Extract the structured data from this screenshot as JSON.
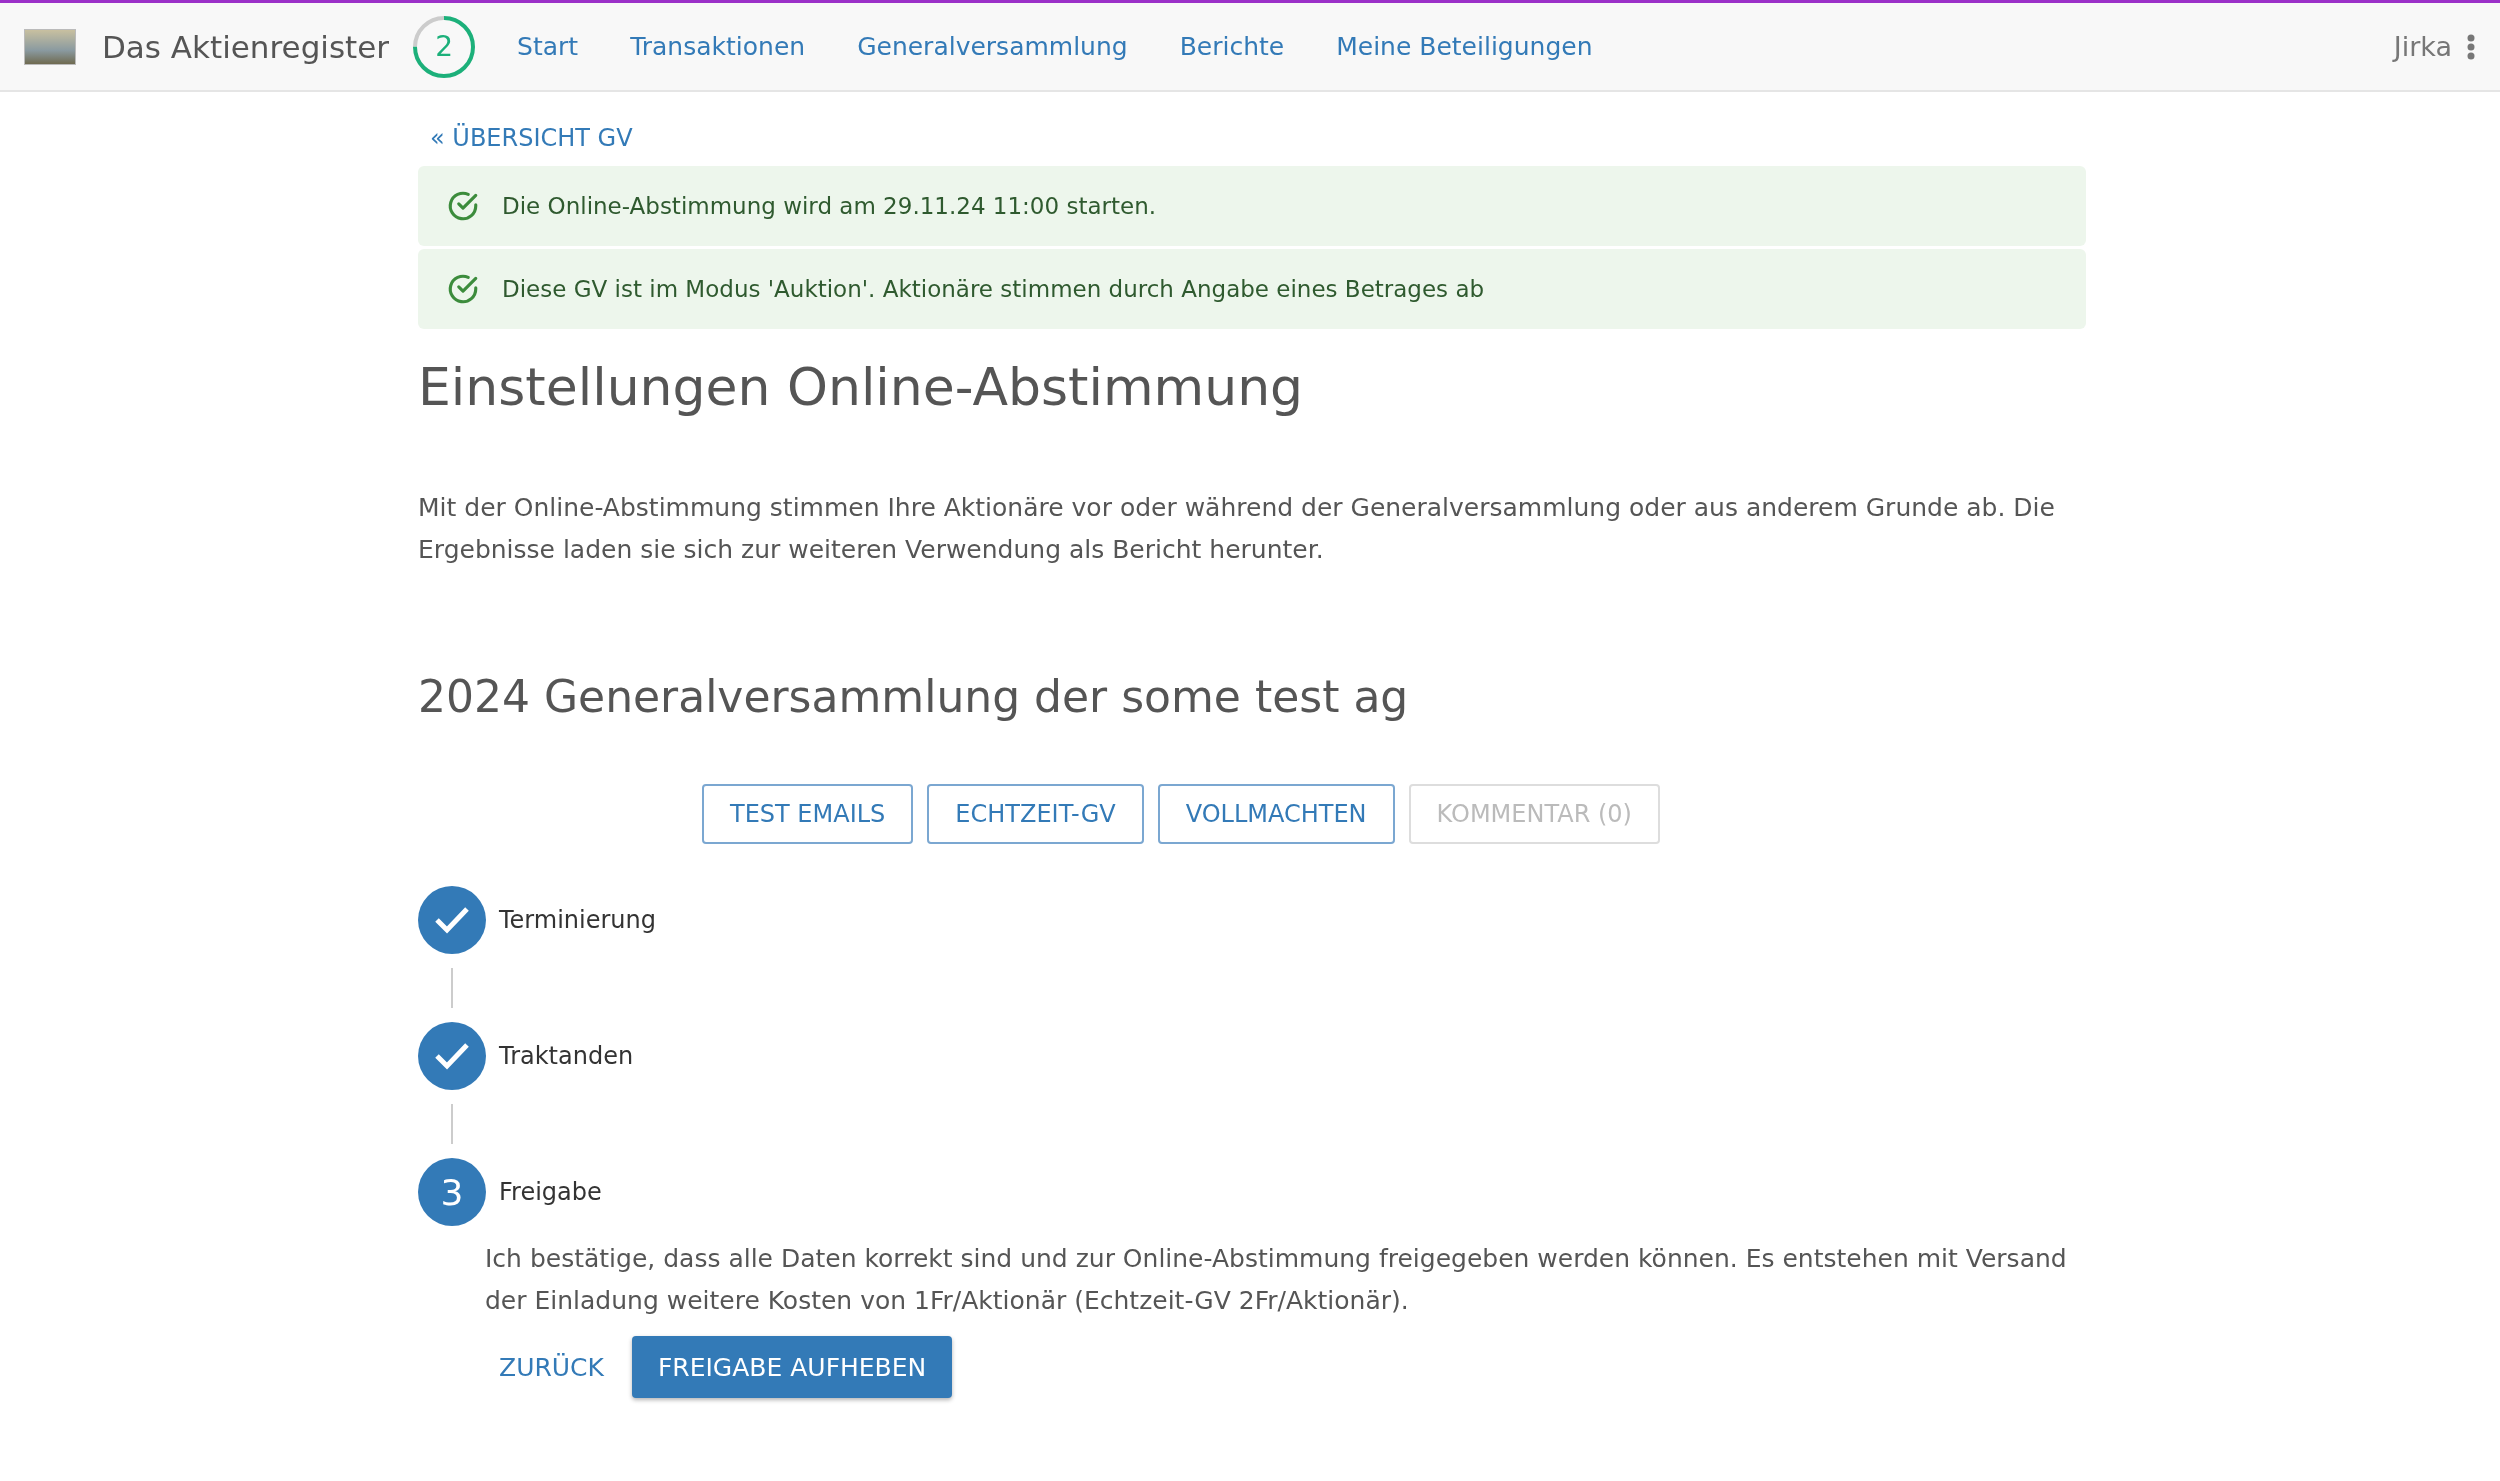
{
  "navbar": {
    "brand": "Das Aktienregister",
    "progress": {
      "count": "2",
      "level": 0.75
    },
    "links": [
      "Start",
      "Transaktionen",
      "Generalversammlung",
      "Berichte",
      "Meine Beteiligungen"
    ],
    "user": "Jirka"
  },
  "back_link": "« ÜBERSICHT GV",
  "alerts": [
    "Die Online-Abstimmung wird am 29.11.24 11:00 starten.",
    "Diese GV ist im Modus 'Auktion'. Aktionäre stimmen durch Angabe eines Betrages ab"
  ],
  "title": "Einstellungen Online-Abstimmung",
  "intro": "Mit der Online-Abstimmung stimmen Ihre Aktionäre vor oder während der Generalversammlung oder aus anderem Grunde ab. Die Ergebnisse laden sie sich zur weiteren Verwendung als Bericht herunter.",
  "subtitle": "2024 Generalversammlung der some test ag",
  "toolbar": [
    {
      "label": "TEST EMAILS",
      "disabled": false
    },
    {
      "label": "ECHTZEIT-GV",
      "disabled": false
    },
    {
      "label": "VOLLMACHTEN",
      "disabled": false
    },
    {
      "label": "KOMMENTAR (0)",
      "disabled": true
    }
  ],
  "steps": [
    {
      "label": "Terminierung",
      "done": true
    },
    {
      "label": "Traktanden",
      "done": true
    },
    {
      "label": "Freigabe",
      "done": false,
      "number": "3",
      "text": "Ich bestätige, dass alle Daten korrekt sind und zur Online-Abstimmung freigegeben werden können. Es entstehen mit Versand der Einladung weitere Kosten von 1Fr/Aktionär (Echtzeit-GV 2Fr/Aktionär).",
      "back": "ZURÜCK",
      "action": "FREIGABE AUFHEBEN"
    }
  ]
}
